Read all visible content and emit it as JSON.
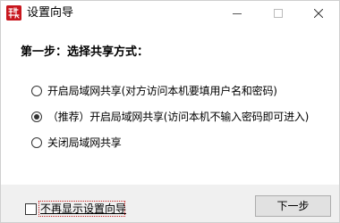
{
  "window": {
    "title": "设置向导",
    "app_icon": "seal-icon",
    "controls": {
      "minimize_icon": "minimize-icon",
      "maximize_icon": "maximize-icon",
      "close_icon": "close-icon"
    }
  },
  "step": {
    "heading": "第一步：选择共享方式："
  },
  "options": [
    {
      "label": "开启局域网共享(对方访问本机要填用户名和密码)",
      "checked": false
    },
    {
      "label": "（推荐）开启局域网共享(访问本机不输入密码即可进入)",
      "checked": true
    },
    {
      "label": "关闭局域网共享",
      "checked": false
    }
  ],
  "footer": {
    "dont_show_label": "不再显示设置向导",
    "dont_show_checked": false,
    "next_label": "下一步"
  },
  "colors": {
    "icon_red": "#c8161d",
    "footer_bg": "#f0f0f0",
    "button_bg": "#e1e1e1",
    "focus_ring": "#c81e1e"
  }
}
